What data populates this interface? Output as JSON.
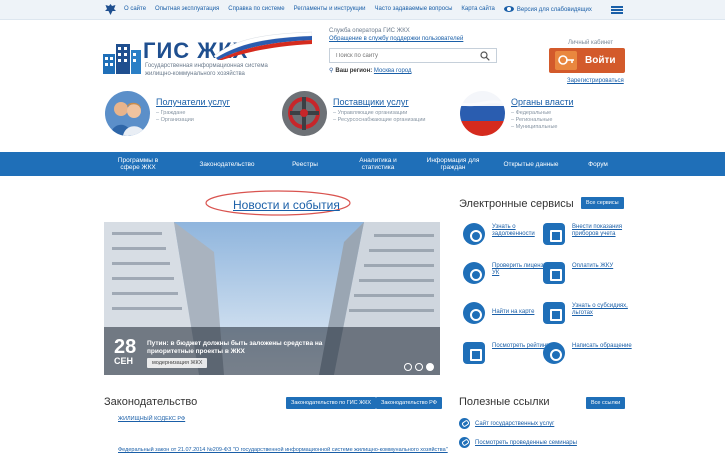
{
  "topbar": {
    "links": [
      "О сайте",
      "Опытная эксплуатация",
      "Справка по системе",
      "Регламенты и инструкции",
      "Часто задаваемые вопросы",
      "Карта сайта"
    ],
    "accessibility_label": "Версия для слабовидящих",
    "emblem_icon": "eagle-emblem-icon",
    "menu_icon": "hamburger-menu-icon"
  },
  "logo": {
    "title": "ГИС ЖКХ",
    "subtitle": "Государственная информационная система жилищно-коммунального хозяйства"
  },
  "service": {
    "title": "Служба оператора ГИС ЖКХ",
    "link": "Обращение в службу поддержки пользователей"
  },
  "search": {
    "placeholder": "Поиск по сайту"
  },
  "region": {
    "label": "Ваш регион:",
    "value": "Москва город"
  },
  "account": {
    "cabinet_label": "Личный кабинет",
    "login_label": "Войти",
    "register_label": "Зарегистрироваться"
  },
  "groups": [
    {
      "title": "Получатели услуг",
      "items": [
        "Граждане",
        "Организации"
      ]
    },
    {
      "title": "Поставщики услуг",
      "items": [
        "Управляющие организации",
        "Ресурсоснабжающие организации"
      ]
    },
    {
      "title": "Органы власти",
      "items": [
        "Федеральные",
        "Региональные",
        "Муниципальные"
      ]
    }
  ],
  "nav": [
    "Программы в сфере ЖКХ",
    "Законодательство",
    "Реестры",
    "Аналитика и статистика",
    "Информация для граждан",
    "Открытые данные",
    "Форум"
  ],
  "news": {
    "title": "Новости и события",
    "day": "28",
    "month": "СЕН",
    "headline": "Путин: в бюджет должны быть заложены средства на приоритетные проекты в ЖКХ",
    "tag": "модернизация ЖКХ",
    "slides_total": 3,
    "slide_active": 3
  },
  "services": {
    "title": "Электронные сервисы",
    "all_label": "Все сервисы",
    "items": [
      {
        "label": "Узнать о задолженности",
        "icon": "debt-icon"
      },
      {
        "label": "Внести показания приборов учета",
        "icon": "meter-icon"
      },
      {
        "label": "Проверить лицензию УК",
        "icon": "license-icon"
      },
      {
        "label": "Оплатить ЖКУ",
        "icon": "payment-icon"
      },
      {
        "label": "Найти на карте",
        "icon": "map-pin-icon"
      },
      {
        "label": "Узнать о субсидиях, льготах",
        "icon": "subsidy-icon"
      },
      {
        "label": "Посмотреть рейтинги",
        "icon": "ratings-icon"
      },
      {
        "label": "Написать обращение",
        "icon": "message-icon"
      }
    ]
  },
  "law": {
    "title": "Законодательство",
    "btn_gis": "Законодательство по ГИС ЖКХ",
    "btn_rf": "Законодательство РФ",
    "link1": "ЖИЛИЩНЫЙ КОДЕКС РФ",
    "link2": "Федеральный закон от 21.07.2014 №209-ФЗ \"О государственной информационной системе жилищно-коммунального хозяйства\""
  },
  "useful": {
    "title": "Полезные ссылки",
    "all_label": "Все ссылки",
    "links": [
      "Сайт государственных услуг",
      "Посмотреть проведенные семинары"
    ]
  }
}
